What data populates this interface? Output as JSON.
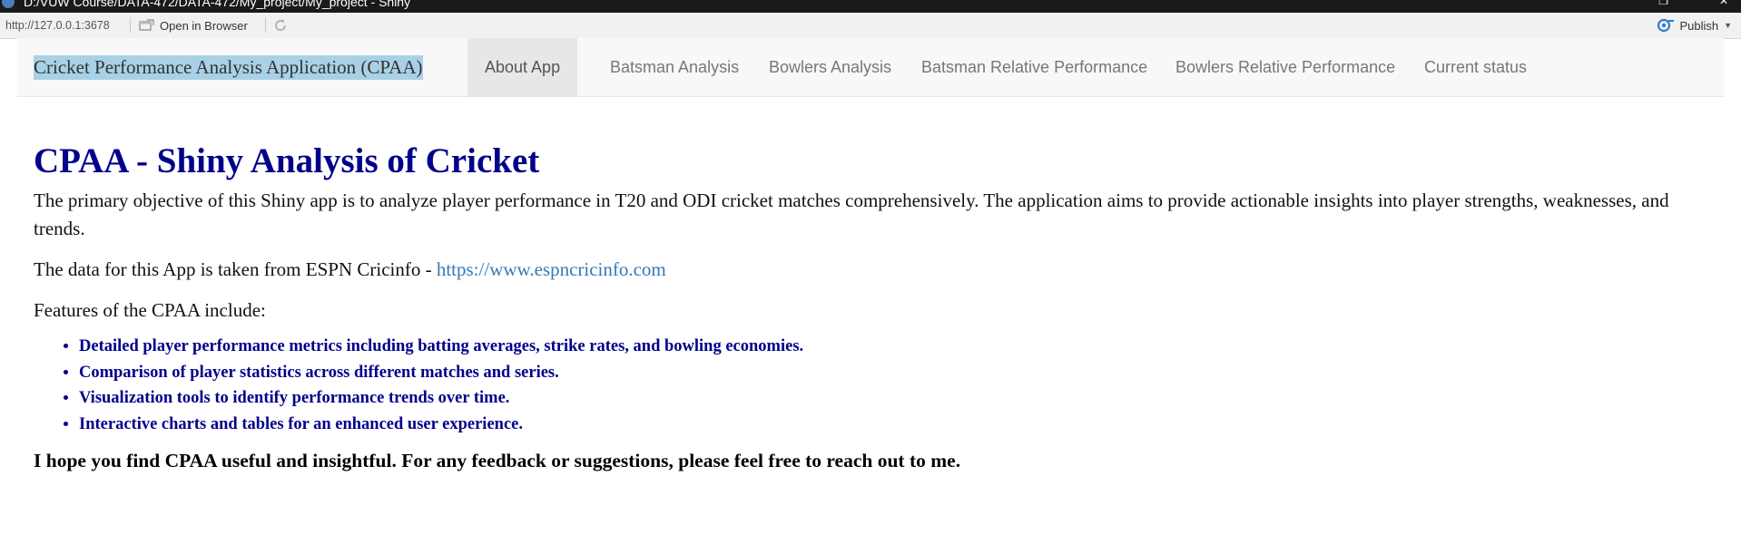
{
  "window": {
    "title": "D:/VUW Course/DATA-472/DATA-472/My_project/My_project - Shiny"
  },
  "viewer": {
    "url": "http://127.0.0.1:3678",
    "open_in_browser": "Open in Browser",
    "publish": "Publish",
    "accent_color": "#2f7fc6"
  },
  "navbar": {
    "brand": "Cricket Performance Analysis Application (CPAA)",
    "tabs": [
      {
        "label": "About App",
        "active": true
      },
      {
        "label": "Batsman Analysis",
        "active": false
      },
      {
        "label": "Bowlers Analysis",
        "active": false
      },
      {
        "label": "Batsman Relative Performance",
        "active": false
      },
      {
        "label": "Bowlers Relative Performance",
        "active": false
      },
      {
        "label": "Current status",
        "active": false
      }
    ]
  },
  "about": {
    "title": "CPAA - Shiny Analysis of Cricket",
    "intro": "The primary objective of this Shiny app is to analyze player performance in T20 and ODI cricket matches comprehensively. The application aims to provide actionable insights into player strengths, weaknesses, and trends.",
    "data_source_prefix": "The data for this App is taken from ESPN Cricinfo - ",
    "data_source_link": "https://www.espncricinfo.com",
    "features_heading": "Features of the CPAA include:",
    "features": [
      "Detailed player performance metrics including batting averages, strike rates, and bowling economies.",
      "Comparison of player statistics across different matches and series.",
      "Visualization tools to identify performance trends over time.",
      "Interactive charts and tables for an enhanced user experience."
    ],
    "closing": "I hope you find CPAA useful and insightful. For any feedback or suggestions, please feel free to reach out to me."
  },
  "colors": {
    "title_color": "#00008b",
    "link_color": "#337ab7",
    "brand_highlight": "#a8d1e6"
  }
}
